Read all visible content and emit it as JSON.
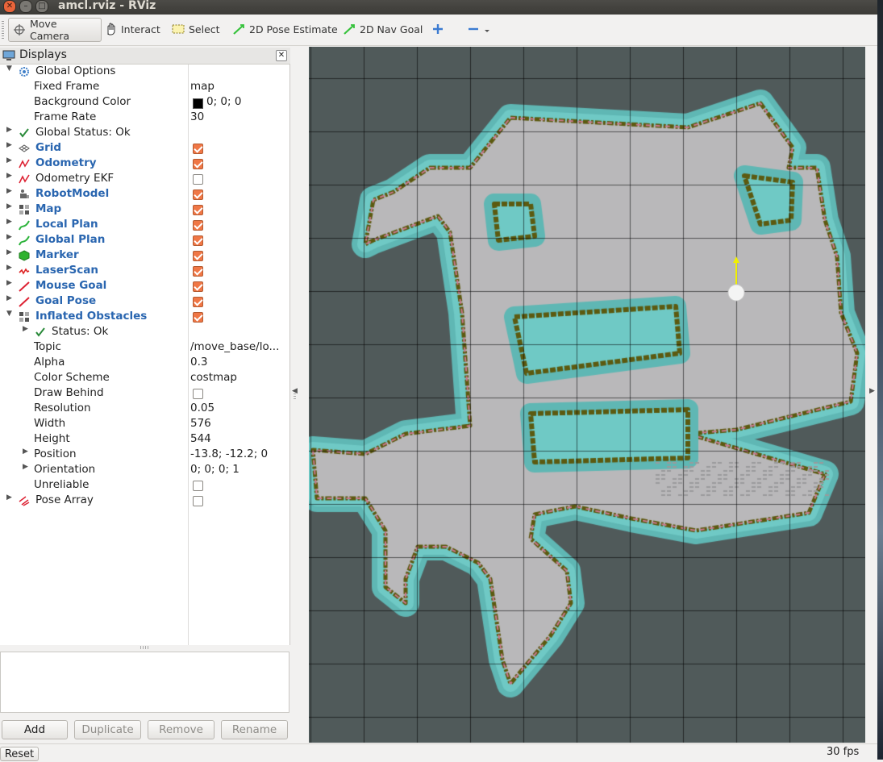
{
  "window": {
    "title": "amcl.rviz - RViz"
  },
  "toolbar": {
    "move_camera": "Move Camera",
    "interact": "Interact",
    "select": "Select",
    "pose_estimate": "2D Pose Estimate",
    "nav_goal": "2D Nav Goal"
  },
  "panel": {
    "title": "Displays"
  },
  "tree": {
    "global_options": "Global Options",
    "fixed_frame": {
      "label": "Fixed Frame",
      "value": "map"
    },
    "background_color": {
      "label": "Background Color",
      "value": "0; 0; 0",
      "swatch": "#000000"
    },
    "frame_rate": {
      "label": "Frame Rate",
      "value": "30"
    },
    "global_status": "Global Status: Ok",
    "displays": [
      {
        "label": "Grid",
        "checked": true,
        "icon": "grid-icon"
      },
      {
        "label": "Odometry",
        "checked": true,
        "icon": "odometry-icon"
      },
      {
        "label": "Odometry EKF",
        "checked": false,
        "icon": "odometry-icon"
      },
      {
        "label": "RobotModel",
        "checked": true,
        "icon": "robot-model-icon"
      },
      {
        "label": "Map",
        "checked": true,
        "icon": "map-icon"
      },
      {
        "label": "Local Plan",
        "checked": true,
        "icon": "path-icon"
      },
      {
        "label": "Global Plan",
        "checked": true,
        "icon": "path-icon"
      },
      {
        "label": "Marker",
        "checked": true,
        "icon": "marker-icon"
      },
      {
        "label": "LaserScan",
        "checked": true,
        "icon": "laser-scan-icon"
      },
      {
        "label": "Mouse Goal",
        "checked": true,
        "icon": "pose-icon"
      },
      {
        "label": "Goal Pose",
        "checked": true,
        "icon": "pose-icon"
      },
      {
        "label": "Inflated Obstacles",
        "checked": true,
        "icon": "map-icon"
      }
    ],
    "inflated": {
      "status": "Status: Ok",
      "topic": {
        "label": "Topic",
        "value": "/move_base/lo..."
      },
      "alpha": {
        "label": "Alpha",
        "value": "0.3"
      },
      "color_scheme": {
        "label": "Color Scheme",
        "value": "costmap"
      },
      "draw_behind": {
        "label": "Draw Behind",
        "checked": false
      },
      "resolution": {
        "label": "Resolution",
        "value": "0.05"
      },
      "width": {
        "label": "Width",
        "value": "576"
      },
      "height": {
        "label": "Height",
        "value": "544"
      },
      "position": {
        "label": "Position",
        "value": "-13.8; -12.2; 0"
      },
      "orientation": {
        "label": "Orientation",
        "value": "0; 0; 0; 1"
      },
      "unreliable": {
        "label": "Unreliable",
        "checked": false
      }
    },
    "pose_array": {
      "label": "Pose Array",
      "checked": false
    }
  },
  "buttons": {
    "add": "Add",
    "duplicate": "Duplicate",
    "remove": "Remove",
    "rename": "Rename"
  },
  "status": {
    "reset": "Reset",
    "fps": "30 fps"
  },
  "colors": {
    "accent_checkbox": "#f07746",
    "label_blue": "#2a66b0",
    "map_free": "#b9b8ba",
    "map_unknown": "#505a5a",
    "inflation": "#5fb7b4",
    "wall": "#5c5a10"
  }
}
